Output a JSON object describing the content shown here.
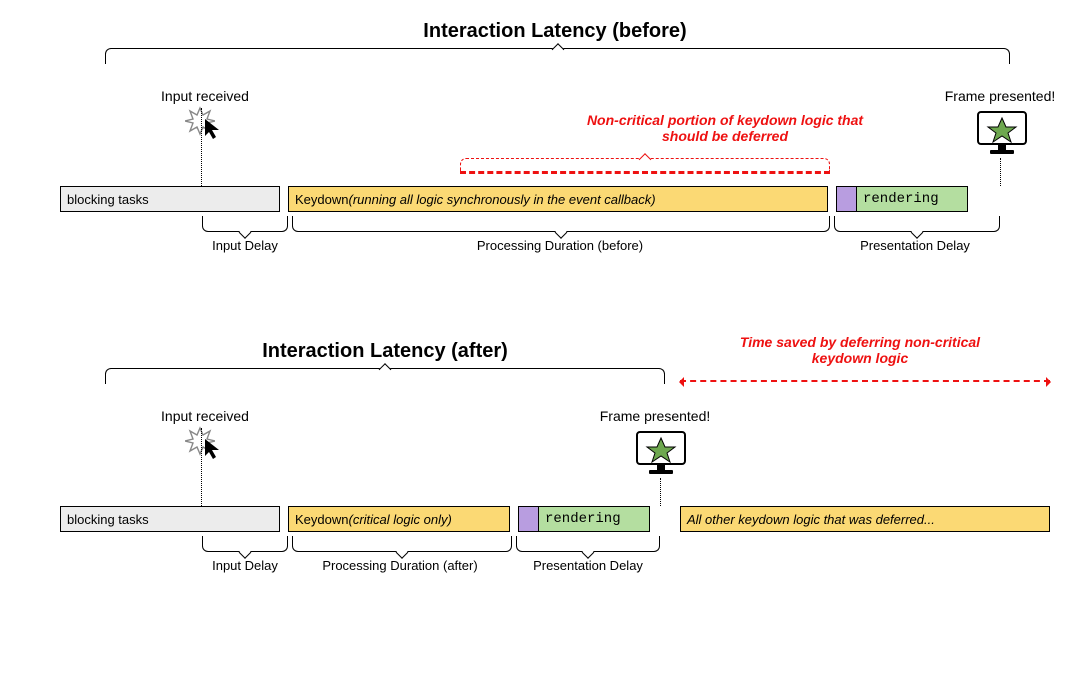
{
  "before": {
    "title": "Interaction Latency (before)",
    "input_received": "Input received",
    "frame_presented": "Frame presented!",
    "noncritical_note": "Non-critical portion of keydown logic that should be deferred",
    "blocking": "blocking tasks",
    "keydown_prefix": "Keydown ",
    "keydown_italic": "(running all logic synchronously in the event callback)",
    "rendering": "rendering",
    "phase_input_delay": "Input Delay",
    "phase_processing": "Processing Duration (before)",
    "phase_presentation": "Presentation Delay"
  },
  "after": {
    "title": "Interaction Latency (after)",
    "input_received": "Input received",
    "frame_presented": "Frame presented!",
    "time_saved_note": "Time saved by deferring non-critical keydown logic",
    "blocking": "blocking tasks",
    "keydown_prefix": "Keydown ",
    "keydown_italic": "(critical logic only)",
    "rendering": "rendering",
    "deferred": "All other keydown logic that was deferred...",
    "phase_input_delay": "Input Delay",
    "phase_processing": "Processing Duration (after)",
    "phase_presentation": "Presentation Delay"
  },
  "colors": {
    "blocking": "#ececec",
    "keydown": "#fbd974",
    "purple": "#b89de0",
    "render": "#b4dea0",
    "red": "#e11"
  }
}
